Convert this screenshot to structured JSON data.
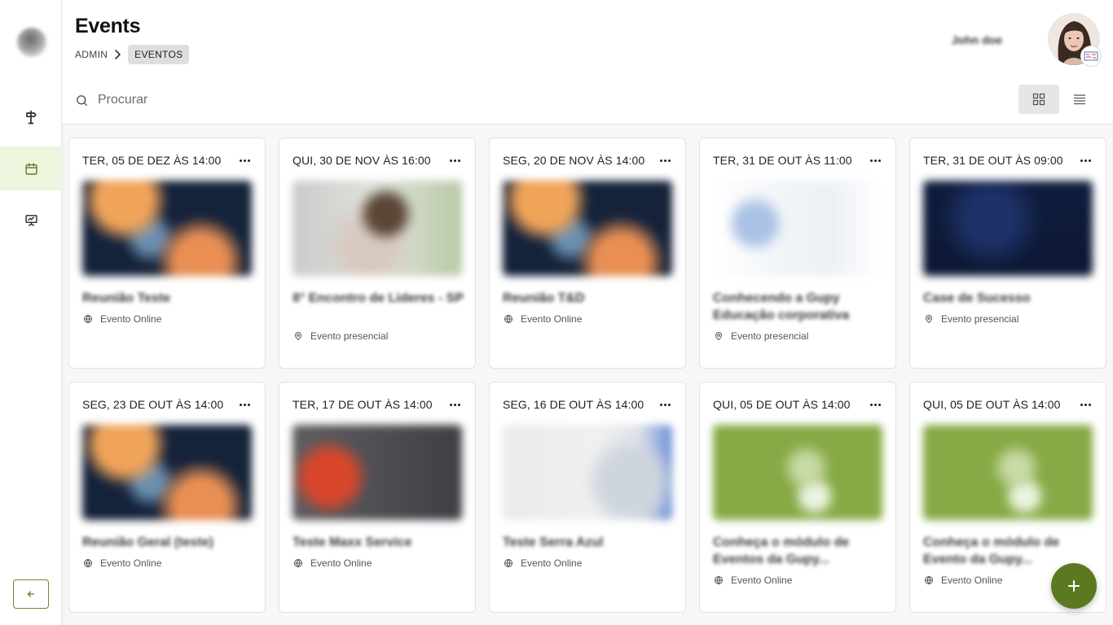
{
  "header": {
    "title": "Events",
    "breadcrumb": {
      "root": "ADMIN",
      "current": "EVENTOS"
    },
    "user_name": "John doe"
  },
  "search": {
    "placeholder": "Procurar"
  },
  "view_toggle": {
    "active": "grid"
  },
  "sidebar": {
    "items": [
      {
        "icon": "signpost-icon",
        "active": false
      },
      {
        "icon": "calendar-icon",
        "active": true
      },
      {
        "icon": "presentation-icon",
        "active": false
      }
    ],
    "collapse_icon": "arrow-left-icon"
  },
  "events": [
    {
      "date": "TER, 05 DE DEZ ÀS 14:00",
      "title": "Reunião Teste",
      "type": "Evento Online",
      "type_icon": "globe-icon"
    },
    {
      "date": "QUI, 30 DE NOV ÀS 16:00",
      "title": "8° Encontro de Lideres - SP",
      "type": "Evento presencial",
      "type_icon": "location-pin-icon"
    },
    {
      "date": "SEG, 20 DE NOV ÀS 14:00",
      "title": "Reunião T&D",
      "type": "Evento Online",
      "type_icon": "globe-icon"
    },
    {
      "date": "TER, 31 DE OUT ÀS 11:00",
      "title": "Conhecendo a Gupy Educação corporativa",
      "type": "Evento presencial",
      "type_icon": "location-pin-icon"
    },
    {
      "date": "TER, 31 DE OUT ÀS 09:00",
      "title": "Case de Sucesso",
      "type": "Evento presencial",
      "type_icon": "location-pin-icon"
    },
    {
      "date": "SEG, 23 DE OUT ÀS 14:00",
      "title": "Reunião Geral (teste)",
      "type": "Evento Online",
      "type_icon": "globe-icon"
    },
    {
      "date": "TER, 17 DE OUT ÀS 14:00",
      "title": "Teste Maxx Service",
      "type": "Evento Online",
      "type_icon": "globe-icon"
    },
    {
      "date": "SEG, 16 DE OUT ÀS 14:00",
      "title": "Teste Serra Azul",
      "type": "Evento Online",
      "type_icon": "globe-icon"
    },
    {
      "date": "QUI, 05 DE OUT ÀS 14:00",
      "title": "Conheça o módulo de Eventos da Gupy...",
      "type": "Evento Online",
      "type_icon": "globe-icon"
    },
    {
      "date": "QUI, 05 DE OUT ÀS 14:00",
      "title": "Conheça o módulo de Evento da Gupy...",
      "type": "Evento Online",
      "type_icon": "globe-icon"
    }
  ],
  "fab": {
    "icon": "plus-icon"
  },
  "colors": {
    "accent": "#5b7a1f",
    "active_bg": "#eef5df"
  }
}
